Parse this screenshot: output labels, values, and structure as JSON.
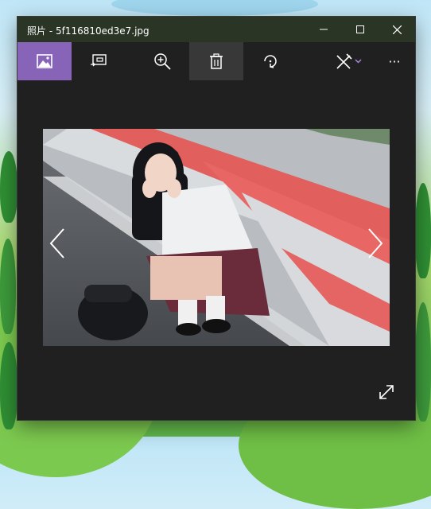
{
  "window": {
    "title": "照片 - 5f116810ed3e7.jpg"
  },
  "toolbar": {
    "items": [
      {
        "name": "image-icon"
      },
      {
        "name": "slideshow-icon"
      },
      {
        "name": "zoom-in-icon"
      },
      {
        "name": "delete-icon"
      },
      {
        "name": "rotate-icon"
      },
      {
        "name": "edit-icon"
      },
      {
        "name": "more-icon"
      }
    ],
    "more_label": "···"
  },
  "colors": {
    "accent": "#8764b8",
    "window_bg": "#202020",
    "titlebar_bg": "#2a3526"
  }
}
